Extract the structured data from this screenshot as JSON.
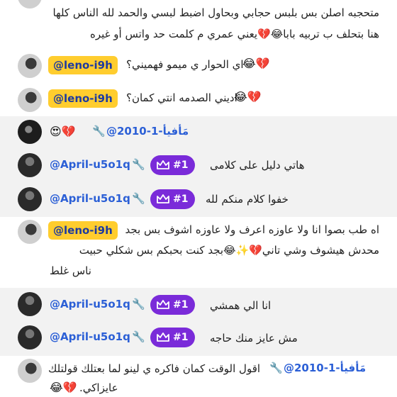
{
  "messages": [
    {
      "lines": [
        "متحجبه اصلن بس بلبس حجابي وبحاول اضبط لبسي والحمد لله الناس كلها",
        "هنا بتحلف ب تربيه بابا😂💔يعني عمري م كلمت حد واتس أو غيره"
      ]
    },
    {
      "mention": "@leno-i9h",
      "text": "اي الحوار ي ميمو فهميني؟",
      "emoji": "😂💔"
    },
    {
      "mention": "@leno-i9h",
      "text": "اديني الصدمه انتي كمان؟",
      "emoji": "😂💔"
    },
    {
      "username": "@مَأفيأ-1-2010",
      "emoji": "😍💔"
    },
    {
      "username": "@April-u5o1q",
      "badge": "#1",
      "text": "هاتي دليل على كلامى"
    },
    {
      "username": "@April-u5o1q",
      "badge": "#1",
      "text": "خفوا كلام منكم لله"
    },
    {
      "mention": "@leno-i9h",
      "lines": [
        "اه طب بصوا انا ولا عاوزه اعرف ولا عاوزه اشوف بس بجد",
        "محدش هيشوف وشي تاني💔✨😂بجد كنت بحبكم بس شكلي حبيت",
        "ناس غلط"
      ]
    },
    {
      "username": "@April-u5o1q",
      "badge": "#1",
      "text": "انا الي همشي"
    },
    {
      "username": "@April-u5o1q",
      "badge": "#1",
      "text": "مش عايز منك حاجه"
    },
    {
      "username": "@مَأفيأ-1-2010",
      "text": "اقول الوقت كمان فاكره ي لينو لما بعتلك قولتلك",
      "line2": "عايزاكي.",
      "emoji": "😂💔"
    }
  ],
  "icons": {
    "wrench": "wrench-icon",
    "crown": "crown-icon"
  },
  "colors": {
    "mention_bg": "#ffcd2e",
    "mention_text": "#1d3aa0",
    "badge_bg": "#7a2bd9",
    "username": "#2b5fd6",
    "alt_row": "#f2f2f2"
  }
}
